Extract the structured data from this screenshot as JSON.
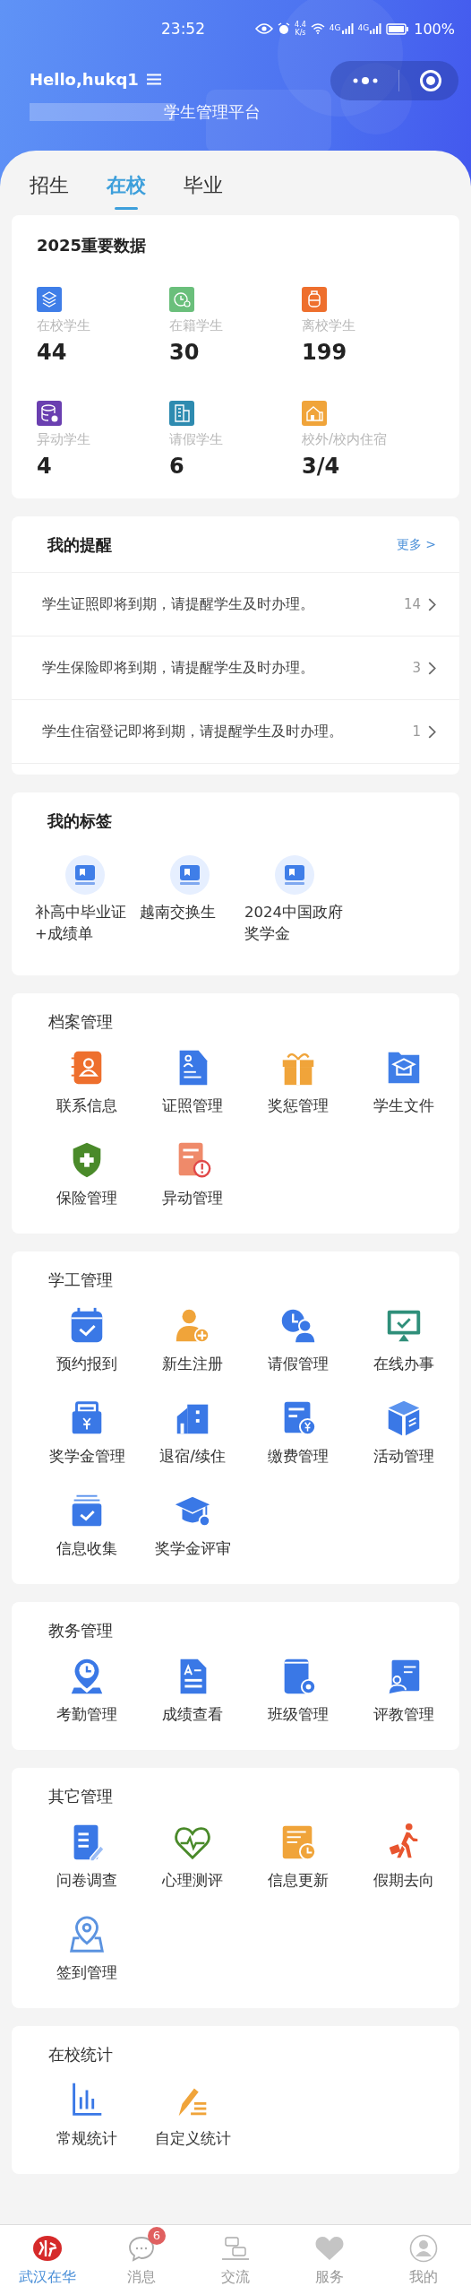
{
  "status_bar": {
    "time": "23:52",
    "speed": [
      "4.4",
      "K/s"
    ],
    "network": [
      "4G",
      "4G"
    ],
    "battery": "100%"
  },
  "header": {
    "greeting": "Hello,hukq1",
    "subtitle": "学生管理平台"
  },
  "tabs": [
    {
      "label": "招生",
      "selected": false
    },
    {
      "label": "在校",
      "selected": true
    },
    {
      "label": "毕业",
      "selected": false
    }
  ],
  "key_data": {
    "title": "2025重要数据",
    "stats": [
      {
        "label": "在校学生",
        "value": "44"
      },
      {
        "label": "在籍学生",
        "value": "30"
      },
      {
        "label": "离校学生",
        "value": "199"
      },
      {
        "label": "异动学生",
        "value": "4"
      },
      {
        "label": "请假学生",
        "value": "6"
      },
      {
        "label": "校外/校内住宿",
        "value": "3/4"
      }
    ]
  },
  "reminders": {
    "title": "我的提醒",
    "more": "更多 >",
    "items": [
      {
        "text": "学生证照即将到期，请提醒学生及时办理。",
        "count": "14"
      },
      {
        "text": "学生保险即将到期，请提醒学生及时办理。",
        "count": "3"
      },
      {
        "text": "学生住宿登记即将到期，请提醒学生及时办理。",
        "count": "1"
      }
    ]
  },
  "tags": {
    "title": "我的标签",
    "items": [
      "补高中毕业证+成绩单",
      "越南交换生",
      "2024中国政府奖学金"
    ]
  },
  "sections": [
    {
      "title": "档案管理",
      "items": [
        "联系信息",
        "证照管理",
        "奖惩管理",
        "学生文件",
        "保险管理",
        "异动管理"
      ]
    },
    {
      "title": "学工管理",
      "items": [
        "预约报到",
        "新生注册",
        "请假管理",
        "在线办事",
        "奖学金管理",
        "退宿/续住",
        "缴费管理",
        "活动管理",
        "信息收集",
        "奖学金评审"
      ]
    },
    {
      "title": "教务管理",
      "items": [
        "考勤管理",
        "成绩查看",
        "班级管理",
        "评教管理"
      ]
    },
    {
      "title": "其它管理",
      "items": [
        "问卷调查",
        "心理测评",
        "信息更新",
        "假期去向",
        "签到管理"
      ]
    },
    {
      "title": "在校统计",
      "items": [
        "常规统计",
        "自定义统计"
      ]
    }
  ],
  "bottom_nav": [
    {
      "label": "武汉在华",
      "selected": true
    },
    {
      "label": "消息",
      "selected": false,
      "badge": "6"
    },
    {
      "label": "交流",
      "selected": false
    },
    {
      "label": "服务",
      "selected": false
    },
    {
      "label": "我的",
      "selected": false
    }
  ]
}
